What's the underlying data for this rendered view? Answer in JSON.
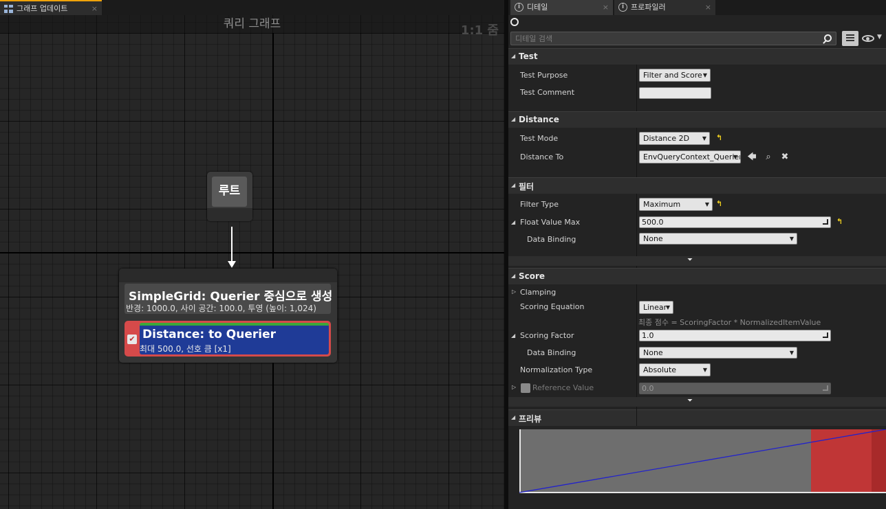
{
  "left_tabs": [
    {
      "label": "그래프 업데이트",
      "close": "×"
    }
  ],
  "graph": {
    "title": "쿼리 그래프",
    "zoom": "1:1 줌",
    "root_node": {
      "label": "루트"
    },
    "generator_node": {
      "title": "SimpleGrid: Querier 중심으로 생성",
      "subtitle": "반경: 1000.0, 사이 공간: 100.0, 투영 (높이: 1,024)"
    },
    "test_node": {
      "title": "Distance: to Querier",
      "subtitle": "최대 500.0, 선호 큼 [x1]",
      "enabled": true
    }
  },
  "right_tabs": [
    {
      "label": "디테일",
      "close": "×",
      "icon": "info-icon"
    },
    {
      "label": "프로파일러",
      "close": "×",
      "icon": "info-icon"
    }
  ],
  "details": {
    "search_placeholder": "디테일 검색",
    "sections": {
      "test": {
        "label": "Test",
        "test_purpose_label": "Test Purpose",
        "test_purpose_value": "Filter and Score",
        "test_comment_label": "Test Comment",
        "test_comment_value": ""
      },
      "distance": {
        "label": "Distance",
        "test_mode_label": "Test Mode",
        "test_mode_value": "Distance 2D",
        "distance_to_label": "Distance To",
        "distance_to_value": "EnvQueryContext_Querier"
      },
      "filter": {
        "label": "필터",
        "filter_type_label": "Filter Type",
        "filter_type_value": "Maximum",
        "float_value_max_label": "Float Value Max",
        "float_value_max_value": "500.0",
        "data_binding_label": "Data Binding",
        "data_binding_value": "None"
      },
      "score": {
        "label": "Score",
        "clamping_label": "Clamping",
        "scoring_equation_label": "Scoring Equation",
        "scoring_equation_value": "Linear",
        "scoring_equation_hint": "최종 점수 = ScoringFactor * NormalizedItemValue",
        "scoring_factor_label": "Scoring Factor",
        "scoring_factor_value": "1.0",
        "data_binding_label": "Data Binding",
        "data_binding_value": "None",
        "normalization_type_label": "Normalization Type",
        "normalization_type_value": "Absolute",
        "reference_value_label": "Reference Value",
        "reference_value_value": "0.0"
      },
      "preview": {
        "label": "프리뷰"
      }
    }
  },
  "colors": {
    "accent_tab": "#f0a30a",
    "node_red": "#d64a4a",
    "node_blue": "#1f3b97",
    "reset_yellow": "#f3d21f",
    "preview_gray": "#6e6e6e",
    "preview_red": "#c03636",
    "preview_line": "#2222cc"
  },
  "preview_curve": {
    "filtered_from_fraction": 0.795,
    "line_start": 0.0,
    "line_end": 1.0
  }
}
